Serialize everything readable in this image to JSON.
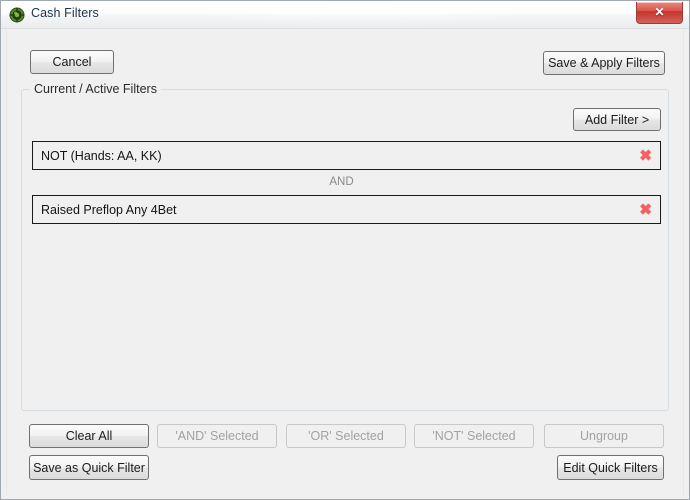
{
  "window": {
    "title": "Cash Filters",
    "icon_name": "poker-chip-icon",
    "close_glyph": "✕"
  },
  "toolbar": {
    "cancel_label": "Cancel",
    "save_apply_label": "Save & Apply Filters"
  },
  "groupbox": {
    "title": "Current / Active Filters",
    "add_filter_label": "Add Filter >",
    "filters": [
      {
        "label": "NOT (Hands: AA, KK)",
        "remove_glyph": "✖"
      },
      {
        "label": "Raised Preflop Any 4Bet",
        "remove_glyph": "✖"
      }
    ],
    "connectors": [
      "AND"
    ]
  },
  "footer": {
    "clear_all_label": "Clear All",
    "and_selected_label": "'AND' Selected",
    "or_selected_label": "'OR' Selected",
    "not_selected_label": "'NOT' Selected",
    "ungroup_label": "Ungroup",
    "save_quick_filter_label": "Save as Quick Filter",
    "edit_quick_filters_label": "Edit Quick Filters"
  },
  "colors": {
    "window_background": "#f0f0f0",
    "close_button": "#c6352c",
    "remove_icon": "#f2615e",
    "connector_text": "#8a8a8a",
    "disabled_text": "#a2a2a2",
    "filter_border": "#1a1a1a"
  }
}
